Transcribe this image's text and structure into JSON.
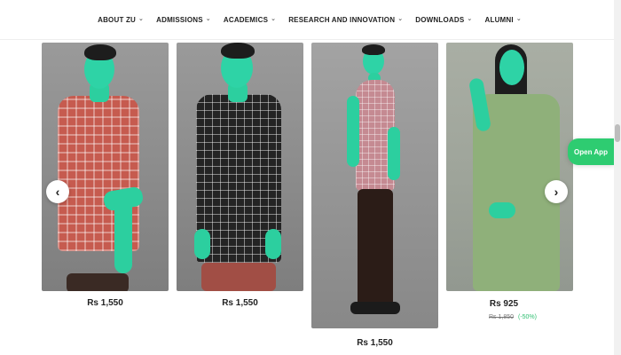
{
  "nav": {
    "items": [
      {
        "label": "ABOUT ZU",
        "icon": "chevron-down-icon"
      },
      {
        "label": "ADMISSIONS",
        "icon": "chevron-down-icon"
      },
      {
        "label": "ACADEMICS",
        "icon": "chevron-down-icon"
      },
      {
        "label": "RESEARCH AND INNOVATION",
        "icon": "chevron-down-icon"
      },
      {
        "label": "DOWNLOADS",
        "icon": "chevron-down-icon"
      },
      {
        "label": "ALUMNI",
        "icon": "chevron-down-icon"
      }
    ]
  },
  "products": [
    {
      "price": "Rs 1,550"
    },
    {
      "price": "Rs 1,550"
    },
    {
      "price": "Rs 1,550"
    },
    {
      "price": "Rs 925",
      "old_price": "Rs 1,850",
      "discount": "(-50%)"
    }
  ],
  "carousel": {
    "prev_icon": "‹",
    "next_icon": "›"
  },
  "open_app": {
    "label": "Open App"
  },
  "colors": {
    "accent_green": "#2ecc71",
    "discount_green": "#2fbf71",
    "model_tint": "#2ed3a6"
  }
}
